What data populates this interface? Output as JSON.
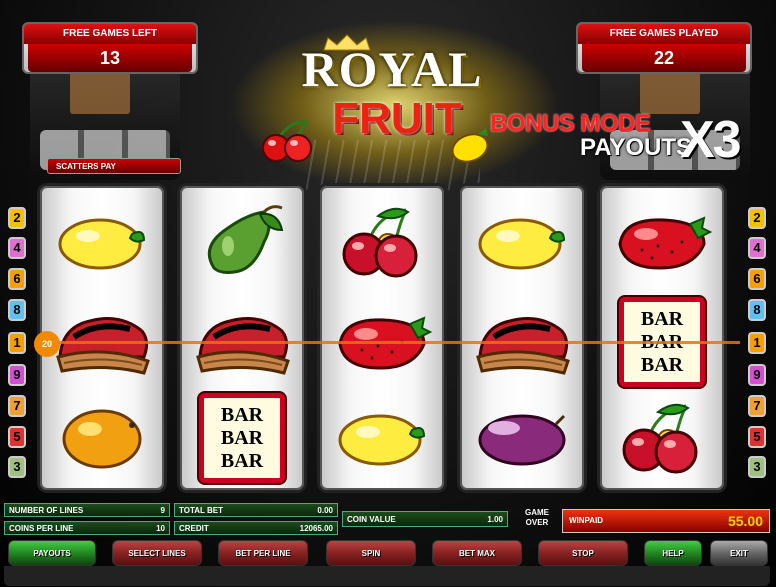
{
  "counters": {
    "free_games_left": {
      "label": "FREE GAMES LEFT",
      "value": "13"
    },
    "free_games_played": {
      "label": "FREE GAMES PLAYED",
      "value": "22"
    }
  },
  "title": {
    "royal": "ROYAL",
    "fruit": "FRUIT",
    "bonus_mode": "BONUS MODE",
    "payouts": "PAYOUTS",
    "multiplier": "X3"
  },
  "scatters_pay": "SCATTERS PAY",
  "reels": [
    [
      "lemon",
      "bell",
      "orange"
    ],
    [
      "pear",
      "bell",
      "bar-bar-bar"
    ],
    [
      "cherries",
      "strawberry",
      "lemon"
    ],
    [
      "lemon",
      "bell",
      "plum"
    ],
    [
      "strawberry",
      "bar-bar-bar",
      "cherries"
    ]
  ],
  "bar_text": [
    "BAR",
    "BAR",
    "BAR"
  ],
  "line_numbers_left": [
    "2",
    "4",
    "6",
    "8",
    "1",
    "9",
    "7",
    "5",
    "3"
  ],
  "line_numbers_right": [
    "2",
    "4",
    "6",
    "8",
    "1",
    "9",
    "7",
    "5",
    "3"
  ],
  "line_colors": [
    "#f6c000",
    "#e070d0",
    "#f6a000",
    "#60c0f0",
    "#f6a000",
    "#d050d0",
    "#f0a030",
    "#e03030",
    "#a0c080"
  ],
  "active_payline": "20",
  "info": {
    "number_of_lines": {
      "label": "NUMBER OF LINES",
      "value": "9"
    },
    "coins_per_line": {
      "label": "COINS PER LINE",
      "value": "10"
    },
    "total_bet": {
      "label": "TOTAL BET",
      "value": "0.00"
    },
    "credit": {
      "label": "CREDIT",
      "value": "12065.00"
    },
    "coin_value": {
      "label": "COIN VALUE",
      "value": "1.00"
    },
    "game_over": "GAME OVER",
    "winpaid": {
      "label": "WINPAID",
      "value": "55.00"
    }
  },
  "buttons": {
    "payouts": "PAYOUTS",
    "select_lines": "SELECT LINES",
    "bet_per_line": "BET PER LINE",
    "spin": "SPIN",
    "bet_max": "BET MAX",
    "stop": "STOP",
    "help": "HELP",
    "exit": "EXIT"
  }
}
